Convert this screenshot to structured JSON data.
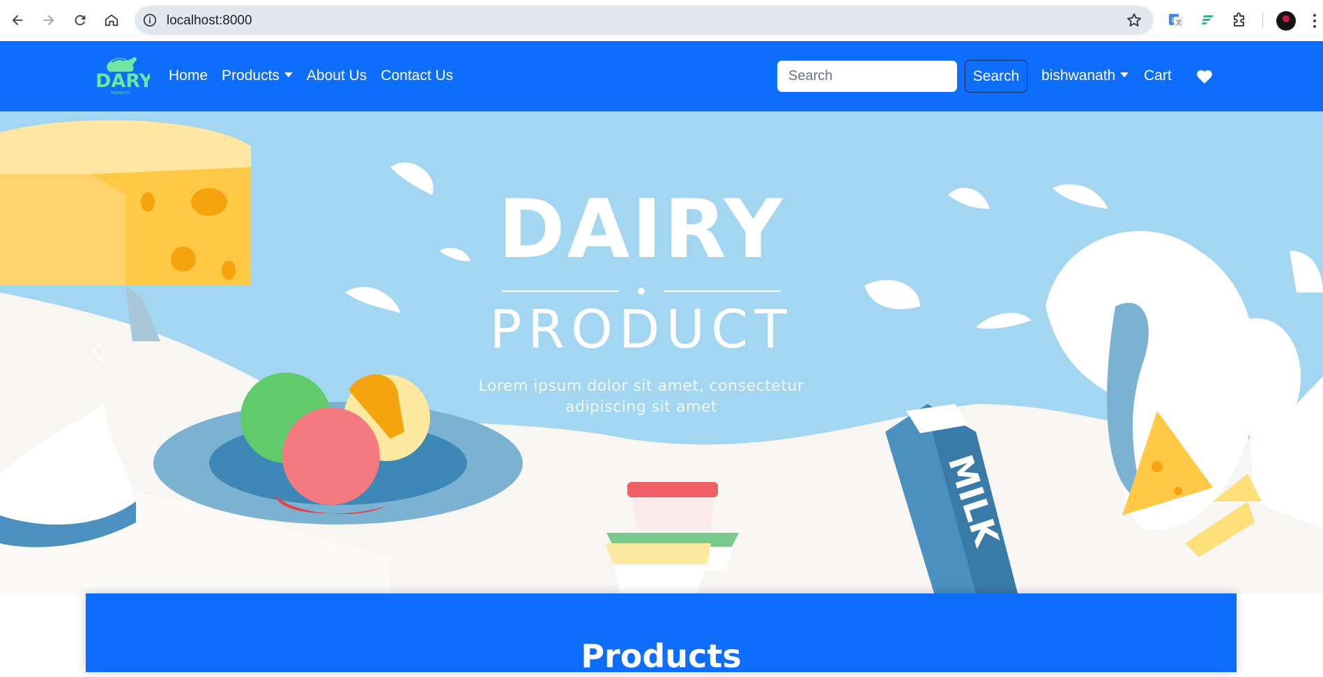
{
  "browser": {
    "url": "localhost:8000",
    "icons": [
      "back-icon",
      "forward-icon",
      "reload-icon",
      "home-icon",
      "site-info-icon",
      "bookmark-star-icon",
      "google-translate-icon",
      "extension-icon",
      "puzzle-icon",
      "profile-avatar",
      "menu-icon"
    ]
  },
  "navbar": {
    "logo_text": "DARY",
    "logo_subtext": "PRODUCTS",
    "links": [
      "Home",
      "Products",
      "About Us",
      "Contact Us"
    ],
    "search_placeholder": "Search",
    "search_button": "Search",
    "user": "bishwanath",
    "cart": "Cart",
    "wishlist_icon": "heart-icon",
    "brand_color": "#0d6efd"
  },
  "hero": {
    "title": "DAIRY",
    "subtitle": "PRODUCT",
    "description": "Lorem ipsum dolor sit amet, consectetur adipiscing sit amet",
    "milk_label": "MILK",
    "prev_icon": "chevron-left-icon"
  },
  "products": {
    "heading": "Products"
  }
}
